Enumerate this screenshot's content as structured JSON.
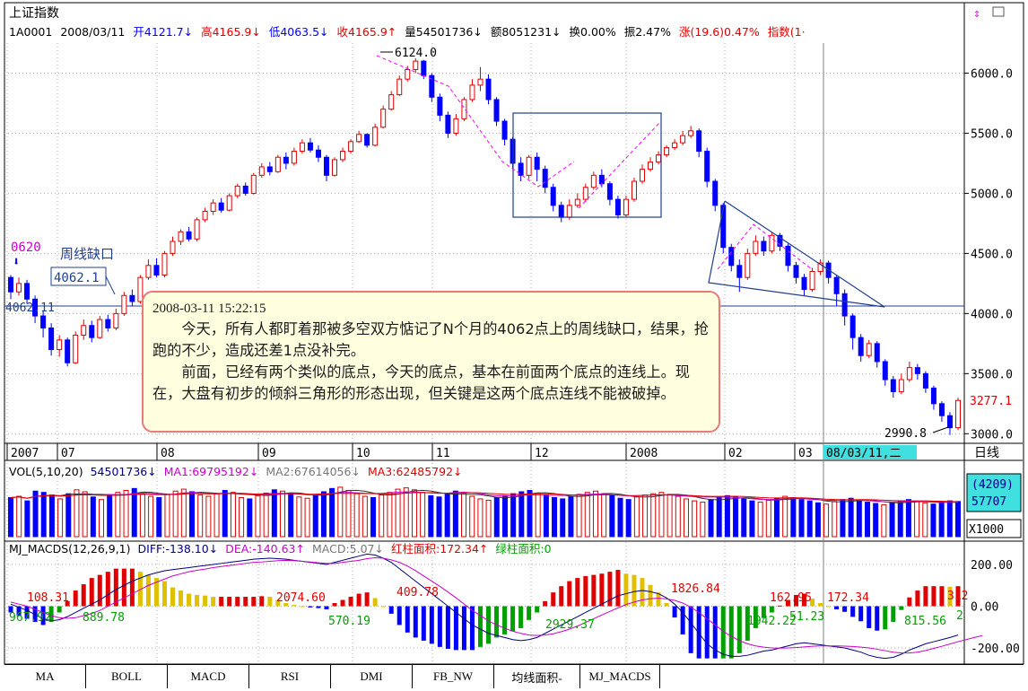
{
  "header": {
    "title": "上证指数",
    "code": "1A0001",
    "date": "2008/03/11",
    "open": "开4121.7↓",
    "high": "高4165.9↓",
    "low": "低4063.5↓",
    "close": "收4165.9↑",
    "volume": "量54501736↓",
    "amount": "额8051231↓",
    "turnover": "换0.00%",
    "amplitude": "振2.47%",
    "change": "涨(19.6)0.47%",
    "index_label": "指数(1·"
  },
  "price_axis": {
    "ticks": [
      "6000.0",
      "5500.0",
      "5000.0",
      "4500.0",
      "4000.0",
      "3500.0",
      "3000.0"
    ],
    "current": "3277.1"
  },
  "annotations": {
    "peak": "6124.0",
    "trough": "2990.8",
    "gap_label": "周线缺口",
    "gap_value": "4062.1",
    "gap_left": "4062.11",
    "marker": "0620"
  },
  "time_axis": {
    "labels": [
      "2007",
      "07",
      "08",
      "09",
      "10",
      "11",
      "12",
      "2008",
      "02",
      "03"
    ],
    "cursor": "08/03/11,二",
    "period": "日线"
  },
  "note": {
    "time": "2008-03-11 15:22:15",
    "p1": "今天，所有人都盯着那被多空双方惦记了N个月的4062点上的周线缺口，结果，抢跑的不少，造成还差1点没补完。",
    "p2": "前面，已经有两个类似的底点，今天的底点，基本在前面两个底点的连线上。现在，大盘有初步的倾斜三角形的形态出现，但关键是这两个底点连线不能被破掉。"
  },
  "volume_panel": {
    "title": "VOL(5,10,20)",
    "vol": "54501736↓",
    "ma1": "MA1:69795192↓",
    "ma2": "MA2:67614056↓",
    "ma3": "MA3:62485792↓",
    "box_top": "(4209)",
    "box_val": "57707",
    "unit": "X1000"
  },
  "macd_panel": {
    "title": "MJ_MACDS(12,26,9,1)",
    "diff": "DIFF:-138.10↓",
    "dea": "DEA:-140.63↑",
    "macd": "MACD:5.07↓",
    "red_area": "红柱面积:172.34↑",
    "green_area": "绿柱面积:0",
    "axis": [
      "200.00",
      "0.00",
      "-200.00"
    ],
    "area_labels": [
      "108.31",
      "967.92",
      "889.78",
      "2074.60",
      "570.19",
      "409.78",
      "2929.37",
      "1826.84",
      "1942.22",
      "162.95",
      "51.23",
      "172.34",
      "815.56",
      "312",
      "2"
    ]
  },
  "tabs": [
    "MA",
    "BOLL",
    "MACD",
    "RSI",
    "DMI",
    "FB_NW",
    "均线面积-",
    "MJ_MACDS"
  ],
  "colors": {
    "up": "#e00000",
    "down": "#0000ff",
    "ma5": "#555555",
    "ma10": "#cc00cc",
    "dea": "#cc00cc",
    "diff": "#000080",
    "hist_up_strong": "#e00000",
    "hist_up_weak": "#e0c000",
    "hist_down_strong": "#0000ff",
    "hist_down_weak": "#00a000",
    "grid": "#b0b0b0",
    "box": "#1f3f8f"
  },
  "chart_data": [
    {
      "type": "candlestick",
      "title": "上证指数",
      "ylim": [
        2950,
        6250
      ],
      "points": [
        [
          4300,
          4180,
          4120,
          4320
        ],
        [
          4180,
          4250,
          4150,
          4300
        ],
        [
          4250,
          4120,
          4080,
          4280
        ],
        [
          4120,
          3980,
          3920,
          4150
        ],
        [
          3980,
          3880,
          3800,
          4020
        ],
        [
          3880,
          3700,
          3650,
          3920
        ],
        [
          3700,
          3780,
          3640,
          3820
        ],
        [
          3780,
          3590,
          3560,
          3800
        ],
        [
          3590,
          3820,
          3580,
          3850
        ],
        [
          3820,
          3900,
          3780,
          3950
        ],
        [
          3900,
          3800,
          3760,
          3940
        ],
        [
          3800,
          3950,
          3790,
          3980
        ],
        [
          3950,
          3880,
          3850,
          3990
        ],
        [
          3880,
          4000,
          3860,
          4040
        ],
        [
          4000,
          4150,
          3980,
          4180
        ],
        [
          4150,
          4100,
          4060,
          4200
        ],
        [
          4100,
          4300,
          4080,
          4320
        ],
        [
          4300,
          4400,
          4280,
          4450
        ],
        [
          4400,
          4320,
          4300,
          4460
        ],
        [
          4320,
          4500,
          4300,
          4520
        ],
        [
          4500,
          4600,
          4480,
          4640
        ],
        [
          4600,
          4680,
          4570,
          4700
        ],
        [
          4680,
          4620,
          4600,
          4720
        ],
        [
          4620,
          4780,
          4600,
          4800
        ],
        [
          4780,
          4850,
          4760,
          4880
        ],
        [
          4850,
          4920,
          4820,
          4950
        ],
        [
          4920,
          4860,
          4840,
          4960
        ],
        [
          4860,
          4980,
          4850,
          5000
        ],
        [
          4980,
          5060,
          4960,
          5080
        ],
        [
          5060,
          5000,
          4980,
          5090
        ],
        [
          5000,
          5150,
          4990,
          5170
        ],
        [
          5150,
          5220,
          5130,
          5250
        ],
        [
          5220,
          5180,
          5150,
          5260
        ],
        [
          5180,
          5300,
          5170,
          5320
        ],
        [
          5300,
          5250,
          5200,
          5340
        ],
        [
          5250,
          5350,
          5230,
          5380
        ],
        [
          5350,
          5420,
          5330,
          5450
        ],
        [
          5420,
          5360,
          5340,
          5460
        ],
        [
          5360,
          5300,
          5260,
          5400
        ],
        [
          5300,
          5150,
          5100,
          5320
        ],
        [
          5150,
          5280,
          5140,
          5300
        ],
        [
          5280,
          5350,
          5260,
          5380
        ],
        [
          5350,
          5430,
          5330,
          5450
        ],
        [
          5430,
          5490,
          5420,
          5520
        ],
        [
          5490,
          5400,
          5380,
          5500
        ],
        [
          5400,
          5550,
          5390,
          5580
        ],
        [
          5550,
          5700,
          5540,
          5730
        ],
        [
          5700,
          5820,
          5690,
          5850
        ],
        [
          5820,
          5950,
          5810,
          5980
        ],
        [
          5950,
          6030,
          5930,
          6060
        ],
        [
          6030,
          6100,
          6000,
          6124
        ],
        [
          6100,
          5980,
          5950,
          6110
        ],
        [
          5980,
          5800,
          5760,
          6000
        ],
        [
          5800,
          5650,
          5600,
          5830
        ],
        [
          5650,
          5500,
          5460,
          5680
        ],
        [
          5500,
          5620,
          5480,
          5660
        ],
        [
          5620,
          5780,
          5600,
          5800
        ],
        [
          5780,
          5900,
          5760,
          5950
        ],
        [
          5900,
          5950,
          5850,
          6050
        ],
        [
          5950,
          5780,
          5740,
          5990
        ],
        [
          5780,
          5600,
          5560,
          5800
        ],
        [
          5600,
          5450,
          5400,
          5620
        ],
        [
          5450,
          5250,
          5200,
          5470
        ],
        [
          5250,
          5150,
          5100,
          5300
        ],
        [
          5150,
          5300,
          5120,
          5320
        ],
        [
          5300,
          5200,
          5100,
          5340
        ],
        [
          5200,
          5050,
          5000,
          5230
        ],
        [
          5050,
          4900,
          4850,
          5080
        ],
        [
          4900,
          4800,
          4760,
          4930
        ],
        [
          4800,
          4900,
          4780,
          4950
        ],
        [
          4900,
          4950,
          4880,
          5000
        ],
        [
          4950,
          5050,
          4930,
          5080
        ],
        [
          5050,
          5150,
          5030,
          5180
        ],
        [
          5150,
          5080,
          5050,
          5200
        ],
        [
          5080,
          4950,
          4900,
          5100
        ],
        [
          4950,
          4820,
          4790,
          4980
        ],
        [
          4820,
          4950,
          4800,
          4980
        ],
        [
          4950,
          5100,
          4930,
          5130
        ],
        [
          5100,
          5200,
          5080,
          5240
        ],
        [
          5200,
          5260,
          5180,
          5300
        ],
        [
          5260,
          5320,
          5240,
          5350
        ],
        [
          5320,
          5380,
          5300,
          5400
        ],
        [
          5380,
          5420,
          5360,
          5450
        ],
        [
          5420,
          5480,
          5400,
          5520
        ],
        [
          5480,
          5520,
          5460,
          5560
        ],
        [
          5520,
          5350,
          5300,
          5540
        ],
        [
          5350,
          5100,
          5050,
          5380
        ],
        [
          5100,
          4900,
          4850,
          5120
        ],
        [
          4900,
          4550,
          4500,
          4920
        ],
        [
          4550,
          4400,
          4350,
          4580
        ],
        [
          4400,
          4300,
          4180,
          4450
        ],
        [
          4300,
          4500,
          4280,
          4540
        ],
        [
          4500,
          4600,
          4480,
          4650
        ],
        [
          4600,
          4520,
          4480,
          4640
        ],
        [
          4520,
          4650,
          4500,
          4680
        ],
        [
          4650,
          4560,
          4520,
          4670
        ],
        [
          4560,
          4400,
          4350,
          4580
        ],
        [
          4400,
          4300,
          4250,
          4430
        ],
        [
          4300,
          4200,
          4150,
          4330
        ],
        [
          4200,
          4350,
          4180,
          4380
        ],
        [
          4350,
          4420,
          4320,
          4450
        ],
        [
          4420,
          4300,
          4250,
          4440
        ],
        [
          4300,
          4165,
          4063,
          4320
        ],
        [
          4165,
          3980,
          3900,
          4200
        ],
        [
          3980,
          3800,
          3700,
          4000
        ],
        [
          3800,
          3650,
          3600,
          3830
        ],
        [
          3650,
          3750,
          3630,
          3780
        ],
        [
          3750,
          3600,
          3550,
          3770
        ],
        [
          3600,
          3450,
          3400,
          3620
        ],
        [
          3450,
          3350,
          3300,
          3480
        ],
        [
          3350,
          3450,
          3330,
          3500
        ],
        [
          3450,
          3550,
          3430,
          3600
        ],
        [
          3550,
          3500,
          3450,
          3580
        ],
        [
          3500,
          3380,
          3340,
          3520
        ],
        [
          3380,
          3250,
          3200,
          3400
        ],
        [
          3250,
          3150,
          3100,
          3270
        ],
        [
          3150,
          3050,
          2990,
          3180
        ],
        [
          3050,
          3277,
          3030,
          3300
        ]
      ]
    },
    {
      "type": "bar",
      "title": "VOL(5,10,20)",
      "unit": "X1000",
      "values": [
        60,
        62,
        55,
        70,
        68,
        64,
        58,
        66,
        72,
        69,
        61,
        57,
        63,
        68,
        71,
        74,
        66,
        62,
        60,
        65,
        70,
        73,
        69,
        64,
        62,
        66,
        71,
        68,
        60,
        58,
        63,
        67,
        72,
        70,
        65,
        61,
        59,
        64,
        69,
        74,
        76,
        71,
        66,
        62,
        60,
        64,
        68,
        73,
        75,
        72,
        68,
        63,
        61,
        65,
        70,
        67,
        62,
        58,
        56,
        60,
        63,
        66,
        69,
        71,
        67,
        64,
        60,
        58,
        62,
        65,
        68,
        70,
        66,
        63,
        59,
        57,
        61,
        64,
        66,
        68,
        65,
        62,
        58,
        55,
        53,
        57,
        60,
        63,
        61,
        58,
        55,
        53,
        56,
        59,
        62,
        60,
        57,
        55,
        52,
        50,
        54,
        57,
        59,
        56,
        53,
        51,
        49,
        52,
        55,
        57,
        54,
        52,
        50,
        53,
        55,
        54
      ]
    },
    {
      "type": "line",
      "title": "MJ_MACDS(12,26,9,1)",
      "ylim": [
        -260,
        230
      ],
      "series": [
        {
          "name": "DIFF",
          "values": [
            10,
            -5,
            -20,
            -40,
            -60,
            -70,
            -65,
            -50,
            -30,
            -10,
            10,
            30,
            55,
            80,
            100,
            120,
            135,
            150,
            160,
            170,
            175,
            180,
            185,
            190,
            195,
            200,
            205,
            210,
            215,
            220,
            225,
            228,
            230,
            228,
            225,
            220,
            215,
            210,
            205,
            200,
            210,
            220,
            230,
            240,
            250,
            245,
            230,
            210,
            180,
            150,
            120,
            90,
            60,
            30,
            0,
            -30,
            -60,
            -90,
            -110,
            -130,
            -140,
            -150,
            -160,
            -165,
            -160,
            -150,
            -130,
            -110,
            -90,
            -70,
            -50,
            -30,
            -10,
            10,
            30,
            50,
            60,
            70,
            75,
            70,
            60,
            40,
            10,
            -30,
            -80,
            -130,
            -180,
            -210,
            -230,
            -240,
            -240,
            -235,
            -225,
            -215,
            -210,
            -200,
            -190,
            -180,
            -175,
            -180,
            -185,
            -190,
            -195,
            -200,
            -210,
            -220,
            -235,
            -245,
            -250,
            -245,
            -230,
            -210,
            -195,
            -180,
            -170,
            -160,
            -150,
            -138
          ]
        },
        {
          "name": "DEA",
          "values": [
            20,
            10,
            0,
            -15,
            -30,
            -45,
            -55,
            -58,
            -55,
            -45,
            -35,
            -20,
            0,
            20,
            40,
            60,
            80,
            100,
            115,
            130,
            145,
            155,
            165,
            172,
            178,
            185,
            190,
            195,
            200,
            205,
            210,
            212,
            215,
            218,
            220,
            218,
            215,
            212,
            208,
            205,
            205,
            210,
            215,
            220,
            228,
            232,
            230,
            222,
            210,
            192,
            170,
            145,
            120,
            95,
            68,
            40,
            10,
            -20,
            -45,
            -70,
            -90,
            -105,
            -120,
            -130,
            -138,
            -140,
            -138,
            -132,
            -122,
            -110,
            -95,
            -78,
            -60,
            -42,
            -25,
            -8,
            8,
            20,
            30,
            36,
            38,
            35,
            28,
            15,
            -5,
            -30,
            -60,
            -90,
            -120,
            -145,
            -165,
            -180,
            -190,
            -196,
            -200,
            -201,
            -200,
            -198,
            -195,
            -192,
            -190,
            -190,
            -190,
            -191,
            -193,
            -196,
            -200,
            -206,
            -213,
            -220,
            -224,
            -224,
            -220,
            -212,
            -202,
            -192,
            -181,
            -170,
            -160,
            -150,
            -140.63
          ]
        }
      ]
    }
  ]
}
